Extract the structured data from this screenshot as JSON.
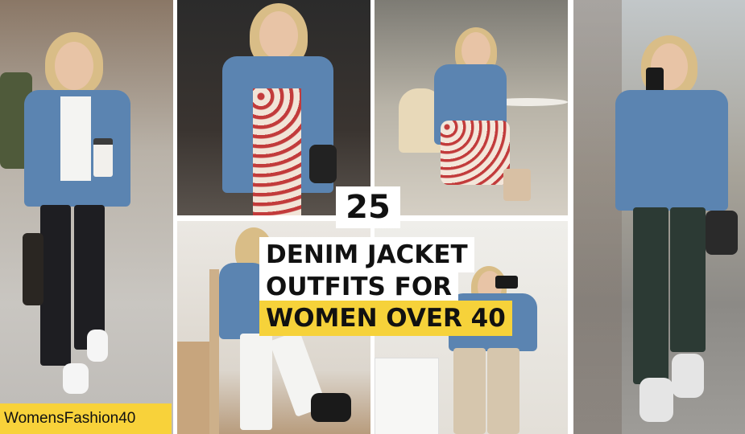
{
  "title": {
    "number": "25",
    "line1": "DENIM JACKET",
    "line2": "OUTFITS FOR",
    "line3": "WOMEN OVER 40"
  },
  "watermark": "WomensFashion40",
  "colors": {
    "highlight": "#f6d23a",
    "denim": "#5b84b1",
    "title_text": "#111111"
  }
}
